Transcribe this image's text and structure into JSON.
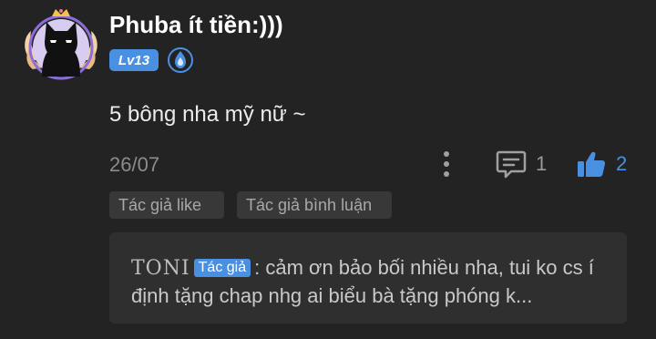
{
  "user": {
    "name": "Phuba ít tiền:)))",
    "level": "Lv13",
    "avatar_icon": "black-cat-with-crown-avatar",
    "rank_icon": "blue-flame-rank-icon"
  },
  "comment": {
    "text": "5 bông nha mỹ nữ ~",
    "date": "26/07"
  },
  "actions": {
    "more_icon": "vertical-dots-icon",
    "reply_icon": "chat-bubble-icon",
    "reply_count": "1",
    "like_icon": "thumbs-up-icon",
    "like_count": "2"
  },
  "chips": {
    "author_liked": "Tác giả like",
    "author_replied": "Tác giả bình luận"
  },
  "reply_preview": {
    "author": "TONI",
    "author_tag": "Tác giả",
    "text": ": cảm ơn bảo bối nhiều nha, tui ko cs í định tặng chap nhg ai biểu bà tặng phóng k..."
  },
  "colors": {
    "background": "#232323",
    "accent": "#4a90e2",
    "chip_bg": "#383838",
    "reply_bg": "#2f2f2f"
  }
}
